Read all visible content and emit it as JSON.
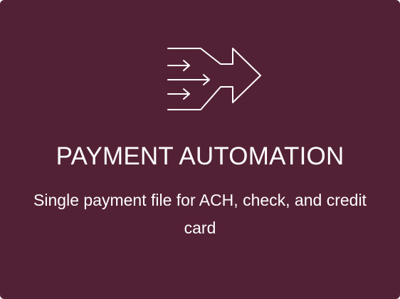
{
  "card": {
    "icon": "merge-arrows-icon",
    "title": "PAYMENT AUTOMATION",
    "description": "Single payment file for ACH, check, and credit card",
    "colors": {
      "background": "#532135",
      "text": "#ffffff"
    }
  }
}
